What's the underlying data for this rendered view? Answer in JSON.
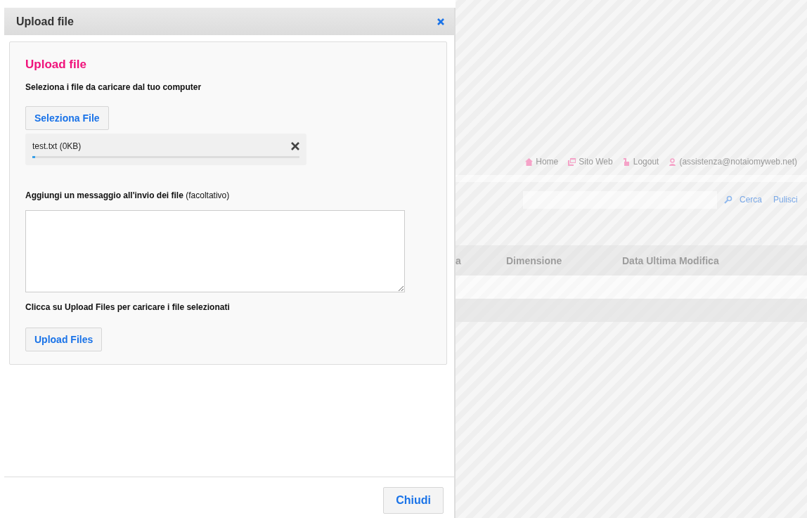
{
  "dialog": {
    "title": "Upload file",
    "panel": {
      "heading": "Upload file",
      "instruction": "Seleziona i file da caricare dal tuo computer",
      "select_button": "Seleziona File",
      "files": [
        {
          "name": "test.txt (0KB)",
          "level": 0.01
        }
      ],
      "message_label": "**Aggiungi un messaggio all'invio dei file** (facoltativo)",
      "upload_hint": "Clicca su Upload Files per caricare i file selezionati",
      "upload_button": "Upload Files"
    },
    "close_button": "Chiudi"
  },
  "background": {
    "nav": [
      {
        "kind": "home",
        "label": "Home"
      },
      {
        "kind": "site",
        "label": "Sito Web"
      },
      {
        "kind": "logout",
        "label": "Logout"
      },
      {
        "kind": "user",
        "label": "(assistenza@notaiomyweb.net)"
      }
    ],
    "search_buttons": [
      "Cerca",
      "Pulisci"
    ],
    "columns": [
      "a",
      "Dimensione",
      "Data Ultima Modifica"
    ]
  }
}
